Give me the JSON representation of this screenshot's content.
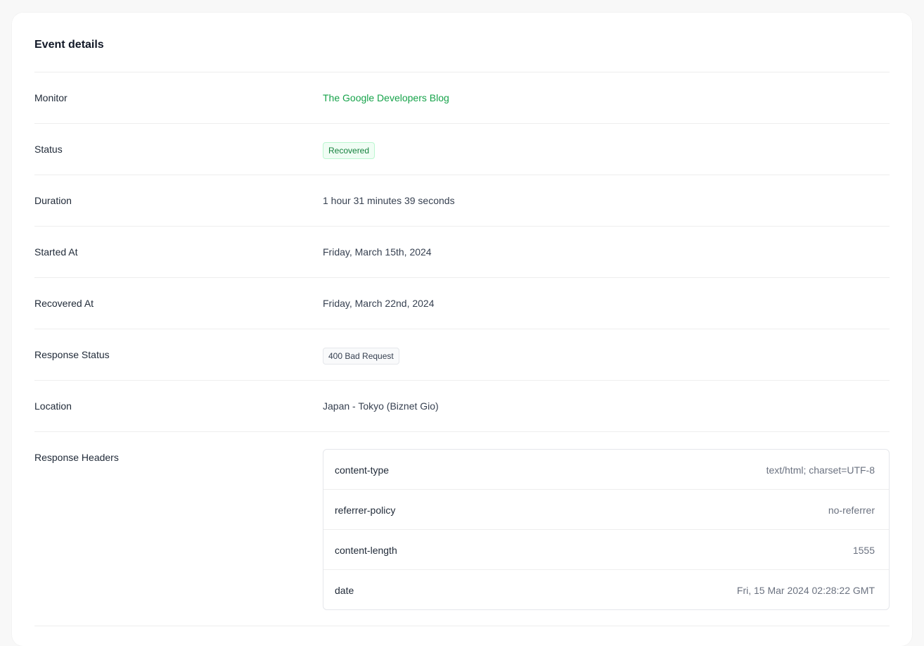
{
  "card": {
    "title": "Event details"
  },
  "fields": {
    "monitor": {
      "label": "Monitor",
      "value": "The Google Developers Blog"
    },
    "status": {
      "label": "Status",
      "value": "Recovered"
    },
    "duration": {
      "label": "Duration",
      "value": "1 hour 31 minutes 39 seconds"
    },
    "started_at": {
      "label": "Started At",
      "value": "Friday, March 15th, 2024"
    },
    "recovered_at": {
      "label": "Recovered At",
      "value": "Friday, March 22nd, 2024"
    },
    "response_status": {
      "label": "Response Status",
      "value": "400 Bad Request"
    },
    "location": {
      "label": "Location",
      "value": "Japan - Tokyo (Biznet Gio)"
    },
    "response_headers": {
      "label": "Response Headers",
      "items": [
        {
          "key": "content-type",
          "value": "text/html; charset=UTF-8"
        },
        {
          "key": "referrer-policy",
          "value": "no-referrer"
        },
        {
          "key": "content-length",
          "value": "1555"
        },
        {
          "key": "date",
          "value": "Fri, 15 Mar 2024 02:28:22 GMT"
        }
      ]
    }
  },
  "colors": {
    "accent_green": "#16a34a",
    "badge_green_bg": "#f0fdf4",
    "badge_green_border": "#bbf7d0",
    "badge_gray_bg": "#f9fafb",
    "badge_gray_border": "#e5e7eb"
  }
}
